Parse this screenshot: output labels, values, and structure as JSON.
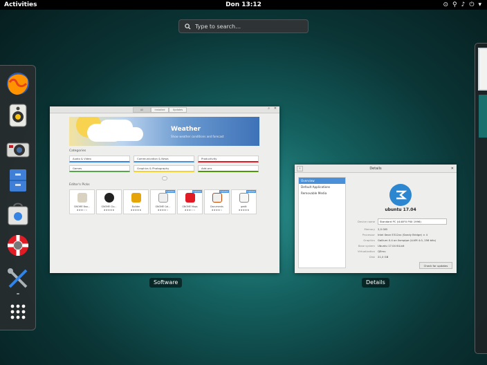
{
  "topbar": {
    "activities": "Activities",
    "clock": "Don 13:12"
  },
  "search": {
    "placeholder": "Type to search…"
  },
  "dash": {
    "apps": [
      "firefox-icon",
      "rhythmbox-icon",
      "cheese-icon",
      "files-icon",
      "software-icon",
      "help-icon",
      "settings-icon",
      "show-apps-icon"
    ]
  },
  "software": {
    "label": "Software",
    "tabs": [
      "All",
      "Installed",
      "Updates"
    ],
    "banner": {
      "title": "Weather",
      "subtitle": "Show weather conditions and forecast"
    },
    "categories_title": "Categories",
    "categories": [
      {
        "label": "Audio & Video",
        "color": "#3584e4"
      },
      {
        "label": "Communication & News",
        "color": "#4a90d9"
      },
      {
        "label": "Productivity",
        "color": "#e01b24"
      },
      {
        "label": "Games",
        "color": "#57a64a"
      },
      {
        "label": "Graphics & Photography",
        "color": "#f6d32d"
      },
      {
        "label": "Add-ons",
        "color": "#4e9a06"
      }
    ],
    "picks_title": "Editor's Picks",
    "picks": [
      {
        "name": "GNOME Boo...",
        "stars": "★★★☆☆",
        "badge": ""
      },
      {
        "name": "GNOME Clo...",
        "stars": "★★★★★",
        "badge": ""
      },
      {
        "name": "Builder",
        "stars": "★★★★★",
        "badge": ""
      },
      {
        "name": "GNOME Cal...",
        "stars": "★★★★☆",
        "badge": "Installed"
      },
      {
        "name": "GNOME Maps",
        "stars": "★★★☆☆",
        "badge": "Installed"
      },
      {
        "name": "Documents",
        "stars": "★★★★☆",
        "badge": "Installed"
      },
      {
        "name": "gedit",
        "stars": "★★★★★",
        "badge": "Installed"
      }
    ]
  },
  "details": {
    "label": "Details",
    "title": "Details",
    "sidebar": [
      "Overview",
      "Default Applications",
      "Removable Media"
    ],
    "os_name": "ubuntu 17.04",
    "device_name_label": "Device name",
    "device_name": "Standard PC (i440FX PIIX 1996)",
    "rows": [
      {
        "k": "Memory",
        "v": "2,0 GiB"
      },
      {
        "k": "Processor",
        "v": "Intel Xeon E312xx (Sandy Bridge) × 4"
      },
      {
        "k": "Graphics",
        "v": "Gallium 0.4 on llvmpipe (LLVM 4.0, 256 bits)"
      },
      {
        "k": "Base system",
        "v": "Ubuntu 17.04 64-bit"
      },
      {
        "k": "Virtualization",
        "v": "QEmu"
      },
      {
        "k": "Disk",
        "v": "21,0 GB"
      }
    ],
    "check_updates": "Check for updates"
  }
}
